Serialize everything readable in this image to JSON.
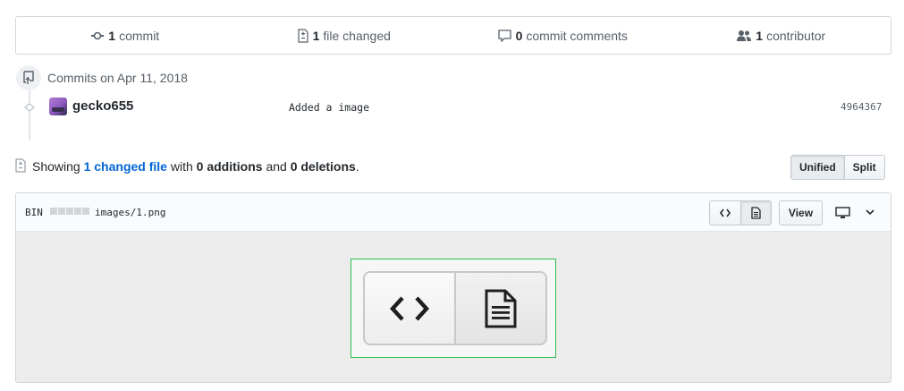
{
  "summary": {
    "commits": {
      "count": "1",
      "label": "commit",
      "icon": "commit-icon"
    },
    "files": {
      "count": "1",
      "label": "file changed",
      "icon": "file-diff-icon"
    },
    "comments": {
      "count": "0",
      "label": "commit comments",
      "icon": "comment-icon"
    },
    "contributors": {
      "count": "1",
      "label": "contributor",
      "icon": "people-icon"
    }
  },
  "commits": {
    "date_label": "Commits on Apr 11, 2018",
    "items": [
      {
        "author": "gecko655",
        "message": "Added a image",
        "sha": "4964367"
      }
    ]
  },
  "toc": {
    "prefix": "Showing",
    "link": "1 changed file",
    "mid1": "with",
    "additions": "0 additions",
    "mid2": "and",
    "deletions": "0 deletions",
    "suffix": "."
  },
  "view_toggle": {
    "unified": "Unified",
    "split": "Split",
    "selected": "Unified"
  },
  "file": {
    "bin_label": "BIN",
    "path": "images/1.png",
    "view_label": "View",
    "diffstat_blocks": 5
  },
  "colors": {
    "link": "#0366d6",
    "image_border": "#2cbe4e"
  }
}
